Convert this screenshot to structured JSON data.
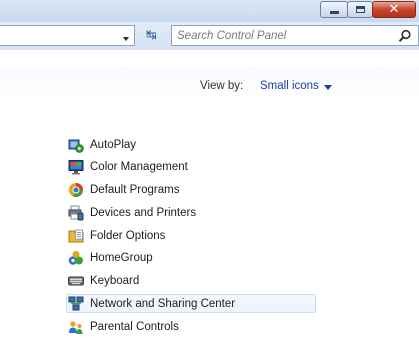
{
  "address_bar": {
    "search_placeholder": "Search Control Panel"
  },
  "view_by": {
    "label": "View by:",
    "value": "Small icons"
  },
  "items": [
    {
      "label": "AutoPlay",
      "icon": "autoplay-icon"
    },
    {
      "label": "Color Management",
      "icon": "color-management-icon"
    },
    {
      "label": "Default Programs",
      "icon": "default-programs-icon"
    },
    {
      "label": "Devices and Printers",
      "icon": "devices-printers-icon"
    },
    {
      "label": "Folder Options",
      "icon": "folder-options-icon"
    },
    {
      "label": "HomeGroup",
      "icon": "homegroup-icon"
    },
    {
      "label": "Keyboard",
      "icon": "keyboard-icon"
    },
    {
      "label": "Network and Sharing Center",
      "icon": "network-sharing-icon",
      "hovered": true
    },
    {
      "label": "Parental Controls",
      "icon": "parental-controls-icon"
    }
  ]
}
